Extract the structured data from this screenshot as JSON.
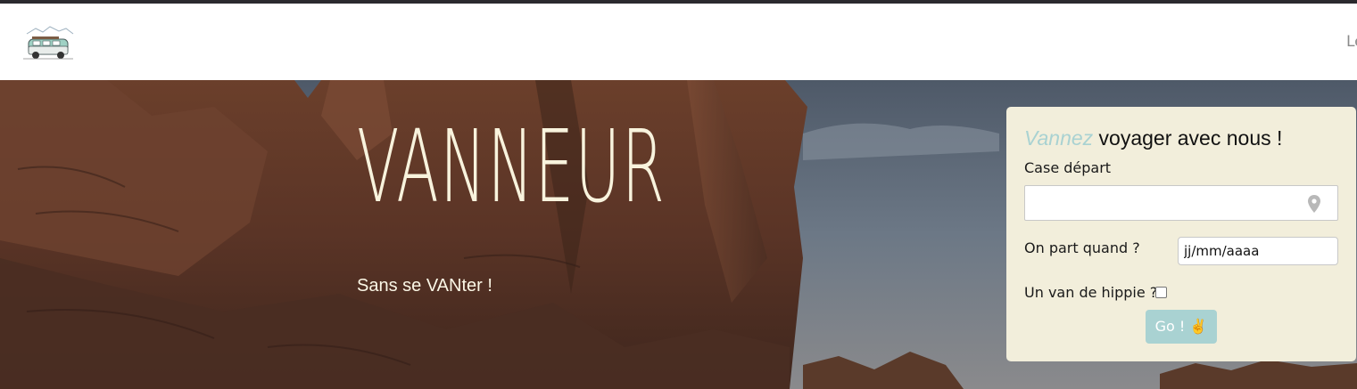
{
  "navbar": {
    "link_label": "Le"
  },
  "hero": {
    "title": "VANNEUR",
    "subtitle": "Sans se VANter !"
  },
  "form": {
    "title_accent": "Vannez",
    "title_rest": " voyager avec nous !",
    "depart_label": "Case départ",
    "depart_value": "",
    "quand_label": "On part quand ?",
    "date_placeholder": "jj/mm/aaaa",
    "hippie_label": "Un van de hippie ?",
    "hippie_checked": false,
    "go_label": "Go ! ✌️"
  },
  "colors": {
    "accent": "#a9d2d2",
    "card_bg": "#f2eedb",
    "hero_text": "#f8f3dd",
    "topline": "#2b2a2e"
  }
}
